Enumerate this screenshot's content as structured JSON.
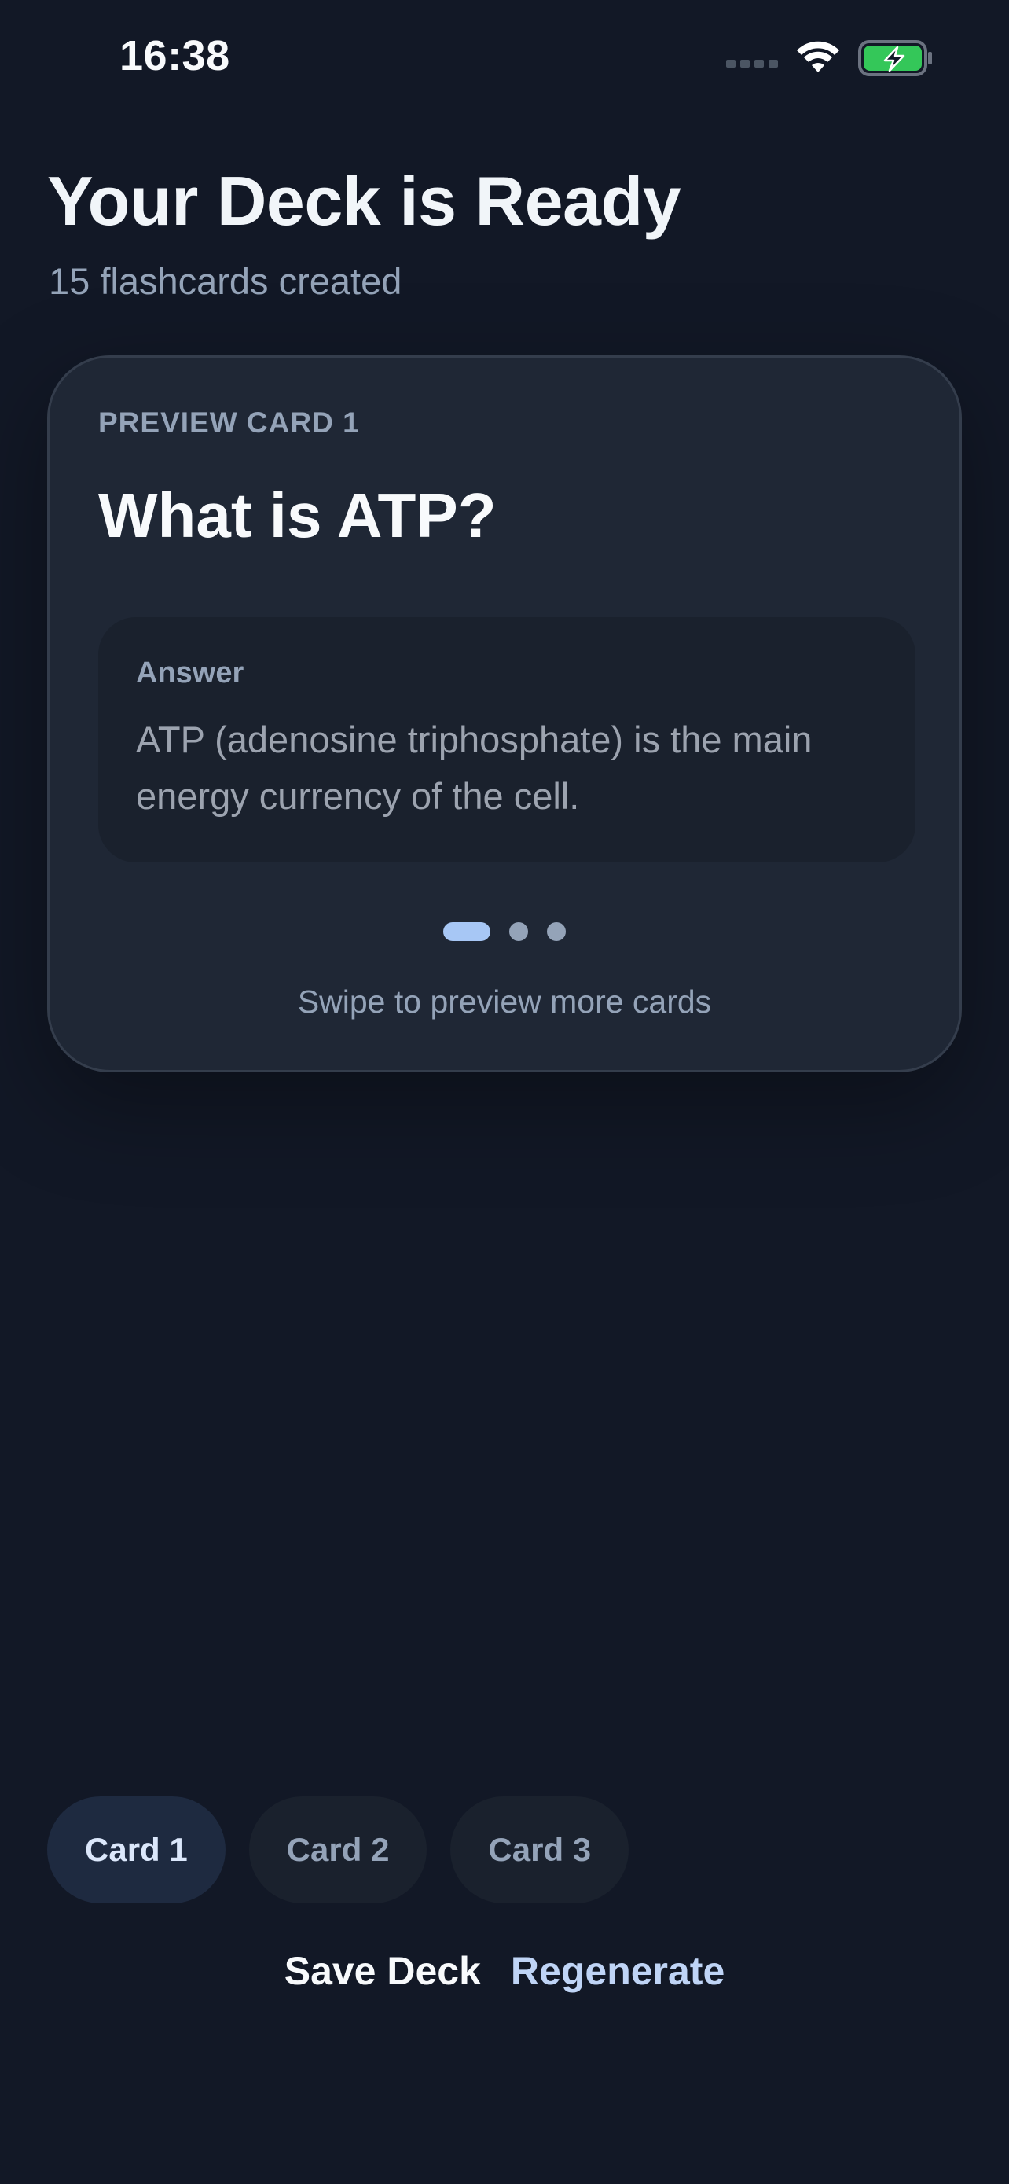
{
  "status_bar": {
    "time": "16:38",
    "icons": [
      "signal-icon",
      "wifi-icon",
      "battery-charging-icon"
    ]
  },
  "header": {
    "title": "Your Deck is Ready",
    "subtitle": "15 flashcards created"
  },
  "preview": {
    "eyebrow": "PREVIEW CARD 1",
    "question": "What is ATP?",
    "answer_label": "Answer",
    "answer_text": "ATP (adenosine triphosphate) is the main energy currency of the cell.",
    "page_index": 1,
    "page_count": 3,
    "hint": "Swipe to preview more cards"
  },
  "chips": [
    {
      "label": "Card 1",
      "selected": true
    },
    {
      "label": "Card 2",
      "selected": false
    },
    {
      "label": "Card 3",
      "selected": false
    }
  ],
  "actions": {
    "save_label": "Save Deck",
    "regenerate_label": "Regenerate"
  },
  "colors": {
    "background": "#121826",
    "card": "#1f2735",
    "accent": "#a7c7f5",
    "battery": "#34c759"
  }
}
